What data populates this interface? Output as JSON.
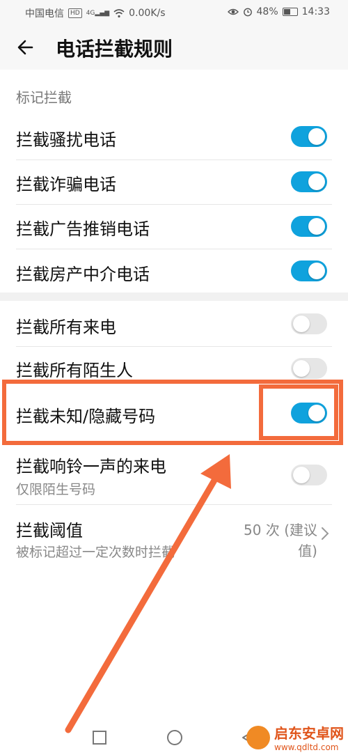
{
  "status_bar": {
    "carrier": "中国电信",
    "hd_badge": "HD",
    "network": "4G",
    "speed": "0.00K/s",
    "battery": "48%",
    "battery_level": 0.48,
    "time": "14:33",
    "icons": [
      "signal-icon",
      "wifi-icon",
      "eye-icon",
      "alarm-icon",
      "battery-icon"
    ]
  },
  "header": {
    "back_icon": "arrow-left-icon",
    "title": "电话拦截规则"
  },
  "section_marked": {
    "header": "标记拦截",
    "items": [
      {
        "label": "拦截骚扰电话",
        "enabled": true
      },
      {
        "label": "拦截诈骗电话",
        "enabled": true
      },
      {
        "label": "拦截广告推销电话",
        "enabled": true
      },
      {
        "label": "拦截房产中介电话",
        "enabled": true
      }
    ]
  },
  "section_general": {
    "items": [
      {
        "label": "拦截所有来电",
        "enabled": false
      },
      {
        "label": "拦截所有陌生人",
        "enabled": false
      },
      {
        "label": "拦截未知/隐藏号码",
        "enabled": true
      },
      {
        "label": "拦截响铃一声的来电",
        "sub": "仅限陌生号码",
        "enabled": false
      }
    ],
    "threshold": {
      "label": "拦截阈值",
      "sub": "被标记超过一定次数时拦截",
      "value": "50 次 (建议值)"
    }
  },
  "annotation": {
    "color": "#f36b3c"
  },
  "nav": {
    "buttons": [
      "square-icon",
      "circle-icon",
      "triangle-back-icon"
    ]
  },
  "watermark": {
    "name": "启东安卓网",
    "url": "www.qdltd.com"
  },
  "colors": {
    "toggle_on": "#0fa2dd",
    "toggle_off": "#e6e6e6",
    "header_bg": "#f7f7f7"
  }
}
